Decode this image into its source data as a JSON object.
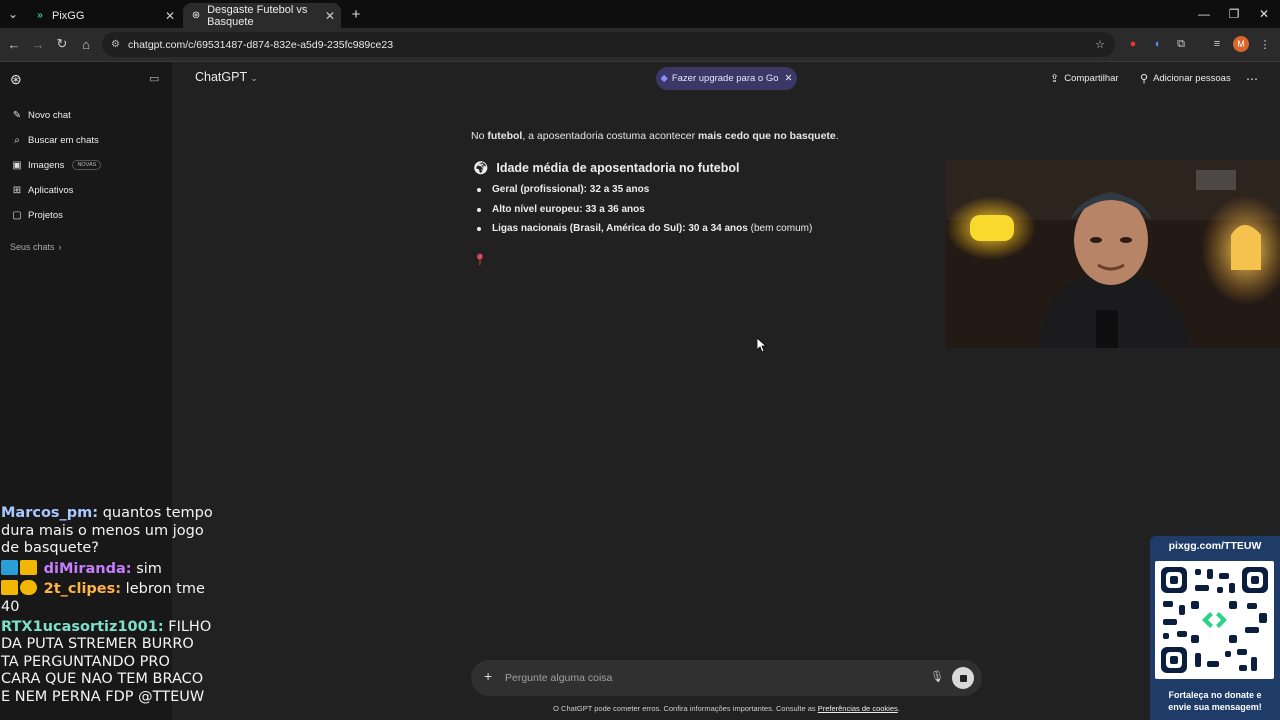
{
  "browser": {
    "tabs": [
      {
        "title": "PixGG",
        "favicon": "pixgg-icon"
      },
      {
        "title": "Desgaste Futebol vs Basquete",
        "favicon": "chatgpt-icon"
      }
    ],
    "url": "chatgpt.com/c/69531487-d874-832e-a5d9-235fc989ce23",
    "profile_initial": "M"
  },
  "sidebar": {
    "items": [
      {
        "label": "Novo chat",
        "icon": "edit-icon"
      },
      {
        "label": "Buscar em chats",
        "icon": "search-icon"
      },
      {
        "label": "Imagens",
        "icon": "image-icon",
        "badge": "NOVAS"
      },
      {
        "label": "Aplicativos",
        "icon": "grid-icon"
      },
      {
        "label": "Projetos",
        "icon": "folder-icon"
      }
    ],
    "section_label": "Seus chats"
  },
  "header": {
    "model": "ChatGPT",
    "upgrade_label": "Fazer upgrade para o Go",
    "share_label": "Compartilhar",
    "add_people_label": "Adicionar pessoas"
  },
  "message": {
    "intro_pre": "No ",
    "intro_b1": "futebol",
    "intro_mid": ", a aposentadoria costuma acontecer ",
    "intro_b2": "mais cedo que no basquete",
    "intro_end": ".",
    "heading": "Idade média de aposentadoria no futebol",
    "bullets": [
      {
        "bold": "Geral (profissional): 32 a 35 anos",
        "rest": ""
      },
      {
        "bold": "Alto nível europeu: 33 a 36 anos",
        "rest": ""
      },
      {
        "bold": "Ligas nacionais (Brasil, América do Sul): 30 a 34 anos",
        "rest": " (bem comum)"
      }
    ]
  },
  "chat_overlay": [
    {
      "user": "Marcos_pm:",
      "color": "#a8c8ff",
      "text": " quantos tempo dura mais o menos um jogo de basquete?"
    },
    {
      "user": "diMiranda:",
      "color": "#c77dff",
      "text": " sim"
    },
    {
      "user": "2t_clipes:",
      "color": "#ffb347",
      "text": " lebron tme 40"
    },
    {
      "user": "RTX1ucasortiz1001:",
      "color": "#7ee0c8",
      "text": " FILHO DA PUTA STREMER BURRO TA PERGUNTANDO PRO CARA QUE NAO TEM BRACO E NEM PERNA FDP @TTEUW"
    }
  ],
  "composer": {
    "placeholder": "Pergunte alguma coisa",
    "footer_text": "O ChatGPT pode cometer erros. Confira informações importantes. Consulte as ",
    "footer_link": "Preferências de cookies",
    "footer_end": "."
  },
  "pixgg": {
    "url": "pixgg.com/TTEUW",
    "cta_line1": "Fortaleça no donate e",
    "cta_line2": "envie sua mensagem!"
  },
  "colors": {
    "background": "#212121",
    "sidebar": "#181818",
    "upgrade_pill": "#3b3868",
    "pix_panel": "#1f3b67"
  }
}
